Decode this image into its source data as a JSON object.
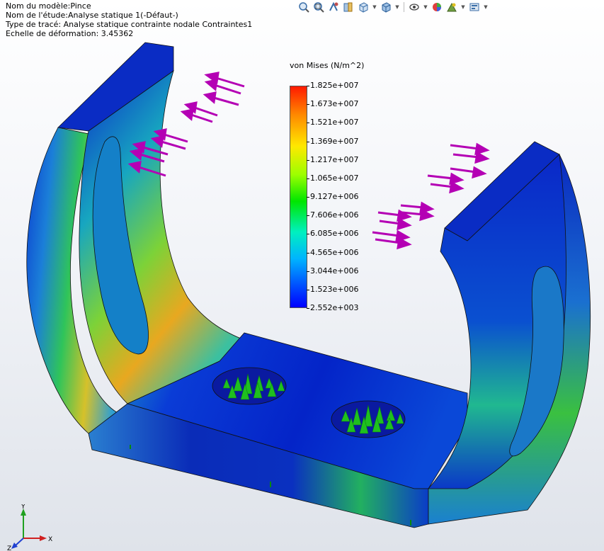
{
  "info": {
    "model_name": "Nom du modèle:Pince",
    "study_name": "Nom de l'étude:Analyse statique 1(-Défaut-)",
    "plot_type": "Type de tracé: Analyse statique contrainte nodale Contraintes1",
    "deformation_scale": "Echelle de déformation: 3.45362"
  },
  "toolbar": {
    "icons": [
      "zoom-to-fit-icon",
      "zoom-to-area-icon",
      "previous-view-icon",
      "section-view-icon",
      "view-orientation-icon",
      "display-style-icon",
      "hide-show-icon",
      "edit-appearance-icon",
      "apply-scene-icon",
      "view-settings-icon"
    ]
  },
  "legend": {
    "title": "von Mises (N/m^2)",
    "labels": [
      "1.825e+007",
      "1.673e+007",
      "1.521e+007",
      "1.369e+007",
      "1.217e+007",
      "1.065e+007",
      "9.127e+006",
      "7.606e+006",
      "6.085e+006",
      "4.565e+006",
      "3.044e+006",
      "1.523e+006",
      "2.552e+003"
    ]
  },
  "triad": {
    "x": "X",
    "y": "Y",
    "z": "Z"
  },
  "colors": {
    "load_arrow": "#b400b4",
    "fixture_arrow": "#00a000",
    "min_stress": "#0000ff",
    "max_stress": "#ff1a00"
  }
}
